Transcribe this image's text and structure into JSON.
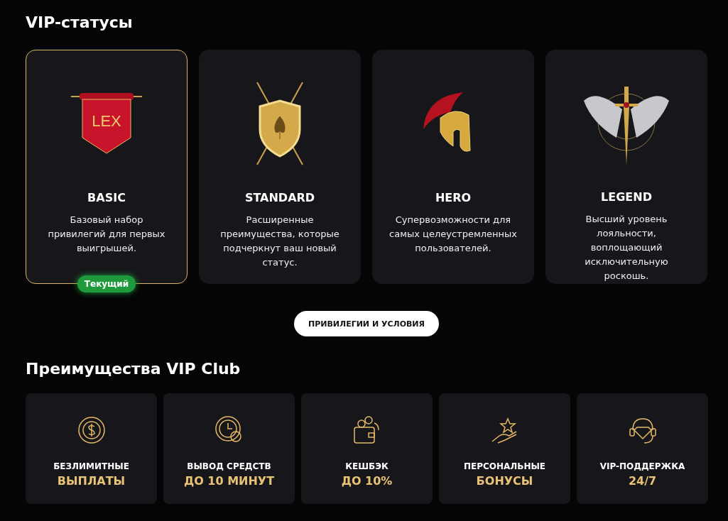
{
  "vip_section": {
    "title": "VIP-статусы",
    "tiers": [
      {
        "kind": "banner",
        "emblem_text": "LEX",
        "name": "BASIC",
        "description": "Базовый набор привилегий для первых выигрышей.",
        "selected": true,
        "badge": "Текущий"
      },
      {
        "kind": "shield",
        "name": "STANDARD",
        "description": "Расширенные преимущества, которые подчеркнут ваш новый статус.",
        "selected": false
      },
      {
        "kind": "helmet",
        "name": "HERO",
        "description": "Супервозможности для самых целеустремленных пользователей.",
        "selected": false
      },
      {
        "kind": "sword",
        "name": "LEGEND",
        "description": "Высший уровень лояльности, воплощающий исключительную роскошь.",
        "selected": false
      }
    ],
    "button": "ПРИВИЛЕГИИ И УСЛОВИЯ"
  },
  "benefits_section": {
    "title": "Преимущества VIP Club",
    "items": [
      {
        "kind": "coin",
        "label": "БЕЗЛИМИТНЫЕ",
        "highlight": "ВЫПЛАТЫ"
      },
      {
        "kind": "clock",
        "label": "ВЫВОД СРЕДСТВ",
        "highlight": "ДО 10 МИНУТ"
      },
      {
        "kind": "wallet",
        "label": "КЕШБЭК",
        "highlight": "ДО 10%"
      },
      {
        "kind": "hand",
        "label": "ПЕРСОНАЛЬНЫЕ",
        "highlight": "БОНУСЫ"
      },
      {
        "kind": "headset",
        "label": "VIP-ПОДДЕРЖКА",
        "highlight": "24/7"
      }
    ]
  }
}
